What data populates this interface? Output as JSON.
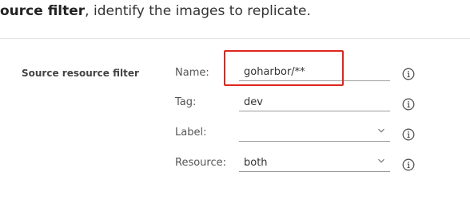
{
  "intro": {
    "bold": "ource filter",
    "rest": ", identify the images to replicate."
  },
  "section": {
    "label": "Source resource filter"
  },
  "fields": {
    "name": {
      "label": "Name:",
      "value": "goharbor/**"
    },
    "tag": {
      "label": "Tag:",
      "value": "dev"
    },
    "label": {
      "label": "Label:",
      "value": ""
    },
    "resource": {
      "label": "Resource:",
      "value": "both"
    }
  },
  "icons": {
    "info": "info-circle-icon",
    "dropdown": "chevron-down-icon"
  },
  "colors": {
    "highlight": "#e0251c",
    "underline": "#9a9a9a",
    "text": "#333333"
  }
}
